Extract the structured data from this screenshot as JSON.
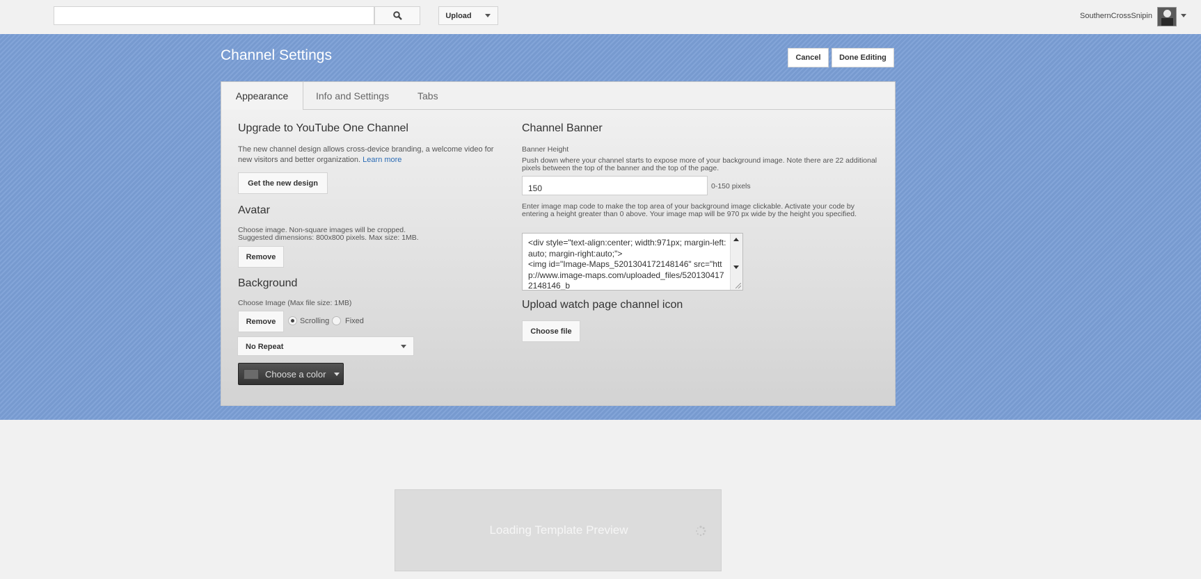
{
  "header": {
    "search": {
      "value": "",
      "placeholder": ""
    },
    "upload_label": "Upload",
    "username": "SouthernCrossSnipin"
  },
  "page": {
    "title": "Channel Settings",
    "cancel_label": "Cancel",
    "done_label": "Done Editing"
  },
  "tabs": [
    {
      "label": "Appearance",
      "active": true
    },
    {
      "label": "Info and Settings",
      "active": false
    },
    {
      "label": "Tabs",
      "active": false
    }
  ],
  "upgrade": {
    "heading": "Upgrade to YouTube One Channel",
    "desc": "The new channel design allows cross-device branding, a welcome video for new visitors and better organization.",
    "link": "Learn more",
    "button": "Get the new design"
  },
  "avatar": {
    "heading": "Avatar",
    "line1": "Choose image. Non-square images will be cropped.",
    "line2": "Suggested dimensions: 800x800 pixels. Max size: 1MB.",
    "remove": "Remove"
  },
  "background": {
    "heading": "Background",
    "desc": "Choose Image (Max file size: 1MB)",
    "remove": "Remove",
    "scrolling": "Scrolling",
    "fixed": "Fixed",
    "selected_attachment": "Scrolling",
    "repeat_value": "No Repeat",
    "color_label": "Choose a color"
  },
  "banner": {
    "heading": "Channel Banner",
    "height_label": "Banner Height",
    "height_desc": "Push down where your channel starts to expose more of your background image. Note there are 22 additional pixels between the top of the banner and the top of the page.",
    "height_value": "150",
    "height_range": "0-150 pixels",
    "map_desc": "Enter image map code to make the top area of your background image clickable. Activate your code by entering a height greater than 0 above. Your image map will be 970 px wide by the height you specified.",
    "map_code": "<div style=\"text-align:center; width:971px; margin-left:auto; margin-right:auto;\">\n<img id=\"Image-Maps_5201304172148146\" src=\"http://www.image-maps.com/uploaded_files/5201304172148146_b"
  },
  "watch_icon": {
    "heading": "Upload watch page channel icon",
    "button": "Choose file"
  },
  "loading": {
    "text": "Loading Template Preview"
  },
  "colors": {
    "banner_bg": "#7b9fd6",
    "link": "#2a6bb5"
  }
}
